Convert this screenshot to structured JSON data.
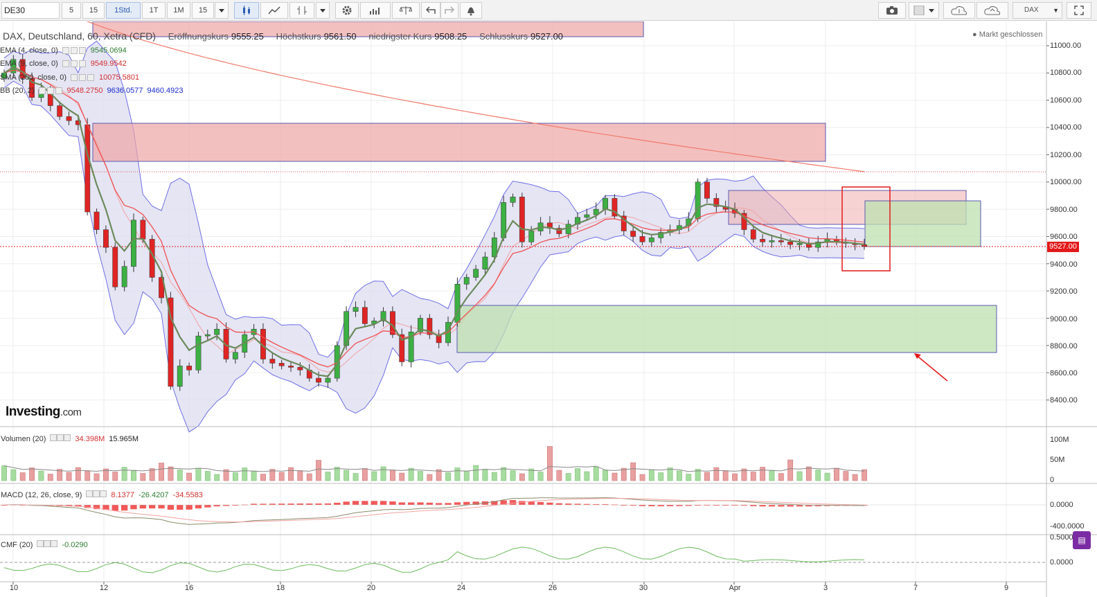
{
  "toolbar": {
    "symbol": "DE30",
    "intervals": [
      "5",
      "15",
      "1Std.",
      "1T",
      "1M",
      "15"
    ],
    "active_interval": "1Std.",
    "exchange": "DAX"
  },
  "header": {
    "title": "DAX, Deutschland, 60, Xetra (CFD)",
    "open_label": "Eröffnungskurs",
    "open_value": "9555.25",
    "high_label": "Höchstkurs",
    "high_value": "9561.50",
    "low_label": "niedrigster Kurs",
    "low_value": "9508.25",
    "close_label": "Schlusskurs",
    "close_value": "9527.00",
    "status": "● Markt geschlossen"
  },
  "indicators": {
    "ema4": {
      "label": "EMA (4, close, 0)",
      "value": "9545.0694"
    },
    "ema9": {
      "label": "EMA (9, close, 0)",
      "value": "9549.9542"
    },
    "sma200": {
      "label": "SMA (200, close, 0)",
      "value": "10075.5801"
    },
    "bb": {
      "label": "BB (20, 2)",
      "mid": "9548.2750",
      "upper": "9636.0577",
      "lower": "9460.4923"
    }
  },
  "price_badge": "9527.00",
  "y_ticks": [
    "11000.00",
    "10800.00",
    "10600.00",
    "10400.00",
    "10200.00",
    "10000.00",
    "9800.00",
    "9600.00",
    "9400.00",
    "9200.00",
    "9000.00",
    "8800.00",
    "8600.00",
    "8400.00"
  ],
  "x_ticks": [
    "10",
    "12",
    "16",
    "18",
    "20",
    "24",
    "26",
    "30",
    "Apr",
    "3",
    "7",
    "9"
  ],
  "volume": {
    "label": "Volumen (20)",
    "value1": "34.398M",
    "value2": "15.965M",
    "ticks": [
      "100M",
      "50M",
      "0"
    ]
  },
  "macd": {
    "label": "MACD (12, 26, close, 9)",
    "v1": "8.1377",
    "v2": "-26.4207",
    "v3": "-34.5583",
    "ticks": [
      "0.0000",
      "-400.0000"
    ]
  },
  "cmf": {
    "label": "CMF (20)",
    "value": "-0.0290",
    "ticks": [
      "0.5000",
      "0.0000"
    ]
  },
  "watermark": {
    "brand": "Investing",
    "suffix": ".com"
  },
  "colors": {
    "up": "#3cb043",
    "down": "#e02424",
    "bb_fill": "#dcdcf0",
    "bb_line": "#6f6fe6",
    "sma": "#f07a6a",
    "ema4": "#6b8a5a",
    "ema9": "#ef5050",
    "resistance_zone": "#eea5a5",
    "support_zone": "#bde0b0",
    "price_line": "#e31919"
  },
  "chart_data": {
    "type": "candlestick",
    "symbol": "DAX",
    "interval": "60",
    "x_label_positions_note": "",
    "closes": [
      10800,
      10900,
      10760,
      10620,
      10680,
      10560,
      10480,
      10450,
      10420,
      9780,
      9650,
      9520,
      9230,
      9380,
      9720,
      9580,
      9300,
      9150,
      8500,
      8650,
      8620,
      8870,
      8880,
      8920,
      8700,
      8750,
      8880,
      8920,
      8700,
      8670,
      8650,
      8640,
      8620,
      8560,
      8530,
      8560,
      8800,
      9050,
      9080,
      8960,
      8980,
      9050,
      8880,
      8680,
      8900,
      9000,
      8880,
      8820,
      8970,
      9250,
      9300,
      9360,
      9450,
      9590,
      9850,
      9890,
      9560,
      9640,
      9700,
      9660,
      9620,
      9690,
      9740,
      9760,
      9800,
      9880,
      9750,
      9640,
      9600,
      9560,
      9590,
      9630,
      9650,
      9680,
      9730,
      10000,
      9880,
      9820,
      9800,
      9770,
      9650,
      9580,
      9560,
      9570,
      9560,
      9540,
      9550,
      9520,
      9560,
      9580,
      9560,
      9550,
      9540,
      9527
    ],
    "resistance_zone": [
      10160,
      10440
    ],
    "support_zone": [
      8760,
      9100
    ],
    "current_price": 9527,
    "sma200_last": 10075.58
  }
}
